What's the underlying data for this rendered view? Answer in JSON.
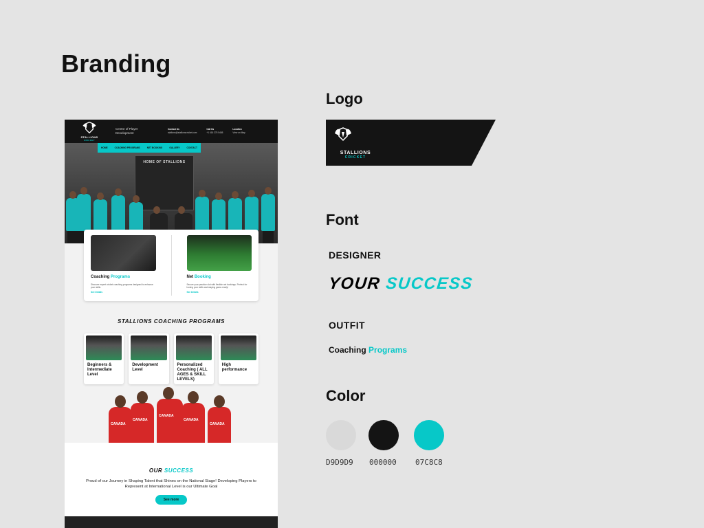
{
  "page": {
    "title": "Branding"
  },
  "mockup": {
    "header": {
      "logo_line1": "STALLIONS",
      "logo_line2": "CRICKET",
      "tagline": "Centre of Player Development",
      "contact": [
        {
          "label": "Contact Us",
          "value": "stallions@stallionscricket.com"
        },
        {
          "label": "Call Us",
          "value": "+1 416 275 5465"
        },
        {
          "label": "Location",
          "value": "View on Map"
        }
      ]
    },
    "nav": [
      "HOME",
      "COACHING PROGRAMS",
      "NET BOOKING",
      "GALLERY",
      "CONTACT"
    ],
    "hero_banner": "HOME OF STALLIONS",
    "cards": [
      {
        "title_a": "Coaching",
        "title_b": "Programs",
        "text": "Discover expert cricket coaching programs designed to enhance your skills.",
        "link": "See Details"
      },
      {
        "title_a": "Net",
        "title_b": "Booking",
        "text": "Secure your practice slot with flexible net bookings. Perfect for honing your skills and staying game-ready!",
        "link": "See Details"
      }
    ],
    "programs_title": "STALLIONS COACHING PROGRAMS",
    "programs": [
      {
        "title": "Beginners & Intermediate Level"
      },
      {
        "title": "Development Level"
      },
      {
        "title": "Personalized Coaching ( ALL AGES & SKILL LEVELS)"
      },
      {
        "title": "High performance"
      }
    ],
    "jersey_text": "CANADA",
    "success": {
      "title_a": "OUR",
      "title_b": "SUCCESS",
      "text": "Proud of our Journey in Shaping Talent that Shines on the National Stage! Developing Players to Represent at International Level is our Ultimate Goal",
      "button": "See more"
    }
  },
  "logo": {
    "heading": "Logo",
    "line1": "STALLIONS",
    "line2": "CRICKET"
  },
  "font": {
    "heading": "Font",
    "designer_label": "DESIGNER",
    "designer_sample_1": "YOUR",
    "designer_sample_2": "SUCCESS",
    "outfit_label": "OUTFIT",
    "outfit_sample_1": "Coaching",
    "outfit_sample_2": "Programs"
  },
  "color": {
    "heading": "Color",
    "swatches": [
      {
        "hex": "#D9D9D9",
        "label": "D9D9D9"
      },
      {
        "hex": "#000000",
        "label": "000000"
      },
      {
        "hex": "#07C8C8",
        "label": "07C8C8"
      }
    ]
  }
}
